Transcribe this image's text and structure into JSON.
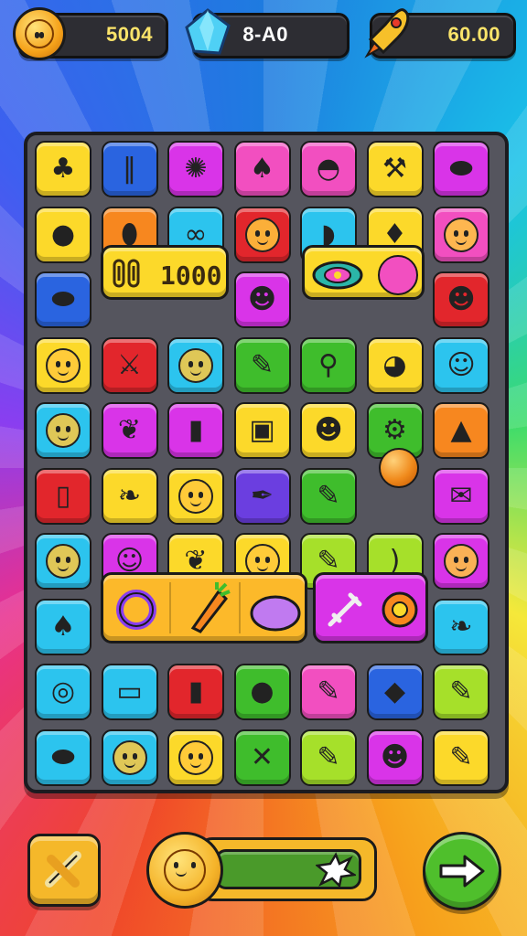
{
  "hud": {
    "coins": {
      "value": "5004",
      "icon": "smiley-coin-icon"
    },
    "gems": {
      "value": "8-A0",
      "icon": "blue-gem-icon"
    },
    "rockets": {
      "value": "60.00",
      "icon": "rocket-icon"
    }
  },
  "wide_tiles": {
    "fries_label": "1000"
  },
  "colors": {
    "yellow": "#fcd92a",
    "orange": "#f7871f",
    "cyan": "#2cc4ee",
    "red": "#e2262c",
    "pink": "#f24fc0",
    "magenta": "#d934e8",
    "green": "#3fbd2c",
    "lime": "#a6e02a",
    "blue": "#2a64e0",
    "purple": "#6b3ee0",
    "board": "#55555e"
  },
  "grid": [
    [
      {
        "c": "yellow",
        "s": "tree"
      },
      {
        "c": "blue",
        "s": "fries"
      },
      {
        "c": "magenta",
        "s": "splat"
      },
      {
        "c": "pink",
        "s": "squid"
      },
      {
        "c": "pink",
        "s": "fish"
      },
      {
        "c": "yellow",
        "s": "hammer"
      },
      {
        "c": "magenta",
        "s": "bean"
      }
    ],
    [
      {
        "c": "yellow",
        "s": "potato"
      },
      {
        "c": "orange",
        "s": "egg"
      },
      {
        "c": "cyan",
        "s": "goggles"
      },
      {
        "c": "red",
        "s": "face"
      },
      {
        "c": "cyan",
        "s": "bread"
      },
      {
        "c": "yellow",
        "s": "acorn"
      },
      {
        "c": "pink",
        "s": "face"
      }
    ],
    [
      {
        "c": "blue",
        "s": "bean"
      },
      null,
      null,
      {
        "c": "magenta",
        "s": "cat"
      },
      null,
      null,
      {
        "c": "red",
        "s": "cat"
      }
    ],
    [
      {
        "c": "yellow",
        "s": "face"
      },
      {
        "c": "red",
        "s": "knife"
      },
      {
        "c": "cyan",
        "s": "face"
      },
      {
        "c": "green",
        "s": "crayon"
      },
      {
        "c": "green",
        "s": "wand"
      },
      {
        "c": "yellow",
        "s": "bird"
      },
      {
        "c": "cyan",
        "s": "ghost"
      }
    ],
    [
      {
        "c": "cyan",
        "s": "face"
      },
      {
        "c": "magenta",
        "s": "pineapple"
      },
      {
        "c": "magenta",
        "s": "bottle"
      },
      {
        "c": "yellow",
        "s": "robot"
      },
      {
        "c": "yellow",
        "s": "frog"
      },
      {
        "c": "green",
        "s": "spanner"
      },
      {
        "c": "orange",
        "s": "poop"
      }
    ],
    [
      {
        "c": "red",
        "s": "popsicle"
      },
      {
        "c": "yellow",
        "s": "feather"
      },
      {
        "c": "yellow",
        "s": "face"
      },
      {
        "c": "purple",
        "s": "pen"
      },
      {
        "c": "green",
        "s": "crayon"
      },
      null,
      {
        "c": "magenta",
        "s": "paper"
      }
    ],
    [
      {
        "c": "cyan",
        "s": "face"
      },
      {
        "c": "magenta",
        "s": "ghost"
      },
      {
        "c": "yellow",
        "s": "leaf"
      },
      {
        "c": "yellow",
        "s": "face"
      },
      {
        "c": "lime",
        "s": "crayon"
      },
      {
        "c": "lime",
        "s": "banana"
      },
      {
        "c": "magenta",
        "s": "face"
      }
    ],
    [
      {
        "c": "cyan",
        "s": "mushroom"
      },
      null,
      null,
      null,
      null,
      null,
      {
        "c": "cyan",
        "s": "feather"
      }
    ],
    [
      {
        "c": "cyan",
        "s": "donut"
      },
      {
        "c": "cyan",
        "s": "bandage"
      },
      {
        "c": "red",
        "s": "bottle"
      },
      {
        "c": "green",
        "s": "plum"
      },
      {
        "c": "pink",
        "s": "pin"
      },
      {
        "c": "blue",
        "s": "drop"
      },
      {
        "c": "lime",
        "s": "crayon"
      }
    ],
    [
      {
        "c": "cyan",
        "s": "bean"
      },
      {
        "c": "cyan",
        "s": "face"
      },
      {
        "c": "yellow",
        "s": "face"
      },
      {
        "c": "green",
        "s": "tools"
      },
      {
        "c": "lime",
        "s": "crayon"
      },
      {
        "c": "magenta",
        "s": "cat"
      },
      {
        "c": "yellow",
        "s": "crayon"
      }
    ]
  ],
  "bottom": {
    "left_button_icon": "hammer-tool-icon",
    "progress_fraction": 0.85,
    "progress_icon": "splat-icon",
    "right_button_icon": "shuffle-arrows-icon"
  }
}
